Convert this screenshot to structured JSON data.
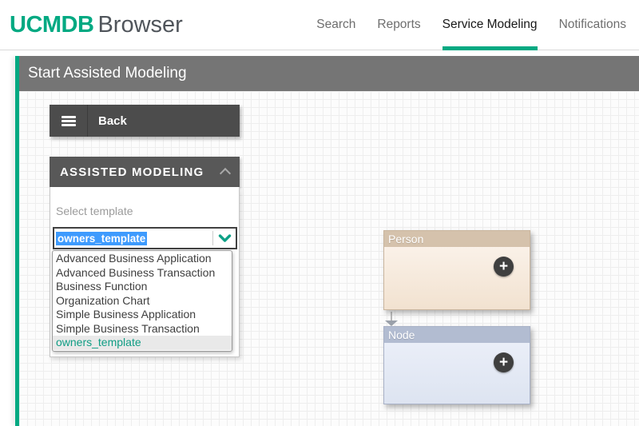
{
  "brand": {
    "primary": "UCMDB",
    "secondary": "Browser"
  },
  "nav": {
    "items": [
      {
        "label": "Search",
        "active": false
      },
      {
        "label": "Reports",
        "active": false
      },
      {
        "label": "Service Modeling",
        "active": true
      },
      {
        "label": "Notifications",
        "active": false
      }
    ]
  },
  "page": {
    "title": "Start Assisted Modeling"
  },
  "sidebar": {
    "back_label": "Back",
    "panel_title": "ASSISTED MODELING",
    "select_label": "Select template",
    "combo": {
      "value": "owners_template"
    },
    "options": [
      "Advanced Business Application",
      "Advanced Business Transaction",
      "Business Function",
      "Organization Chart",
      "Simple Business Application",
      "Simple Business Transaction",
      "owners_template"
    ],
    "selected_option": "owners_template"
  },
  "canvas": {
    "add_label": "+",
    "nodes": [
      {
        "label": "Person"
      },
      {
        "label": "Node"
      }
    ]
  },
  "colors": {
    "accent": "#01a982",
    "selection_blue": "#3e9bfd",
    "titlebar_gray": "#757575",
    "panel_gray": "#585858",
    "person_header": "#d5c2ac",
    "node_header": "#b2bcd1"
  }
}
